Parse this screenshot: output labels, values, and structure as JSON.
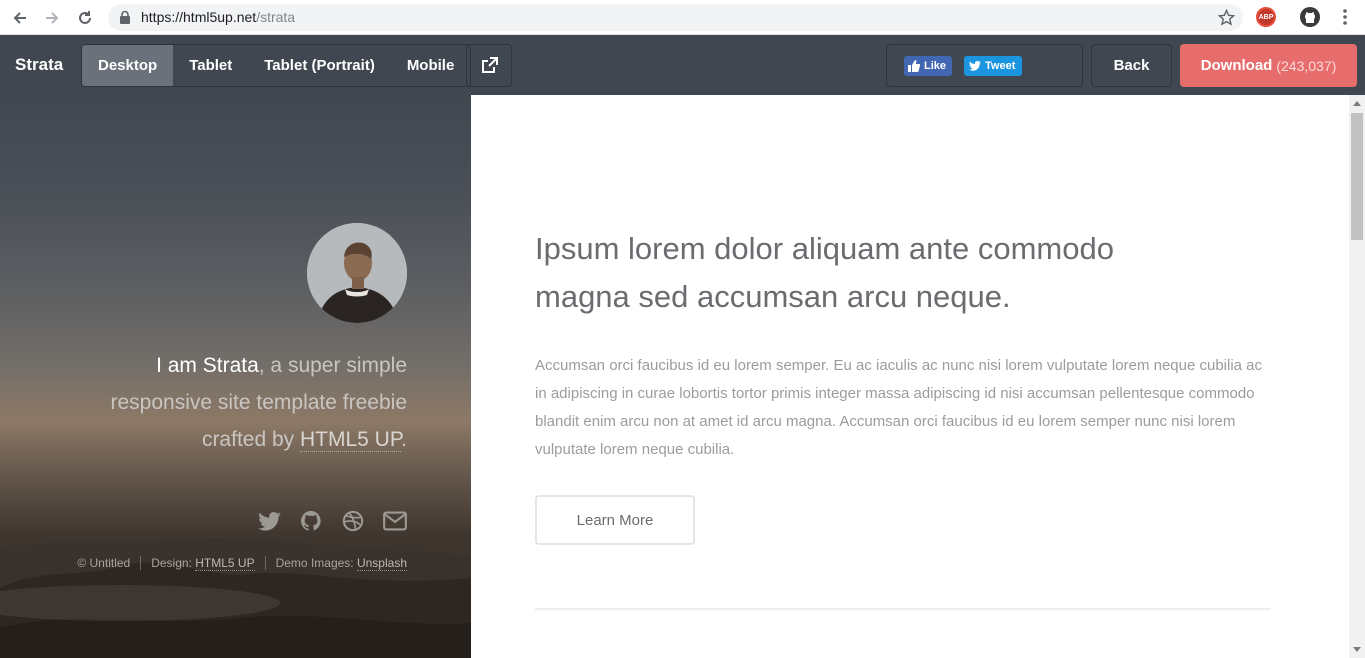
{
  "browser": {
    "url_host": "https://html5up.net",
    "url_path": "/strata",
    "extensions": [
      {
        "name": "adblock-plus-icon",
        "label": "ABP"
      },
      {
        "name": "github-extension-icon"
      }
    ]
  },
  "toolbar": {
    "brand": "Strata",
    "viewports": [
      {
        "label": "Desktop",
        "active": true
      },
      {
        "label": "Tablet",
        "active": false
      },
      {
        "label": "Tablet (Portrait)",
        "active": false
      },
      {
        "label": "Mobile",
        "active": false
      }
    ],
    "popout_icon": "external-link-icon",
    "like_label": "Like",
    "tweet_label": "Tweet",
    "back_label": "Back",
    "download_label": "Download",
    "download_count": "(243,037)",
    "colors": {
      "bar": "#414750",
      "download": "#e76d6d",
      "active_tab": "#6b717b"
    }
  },
  "sidebar": {
    "intro_strong": "I am Strata",
    "intro_text": ", a super simple responsive site template freebie crafted by ",
    "intro_link": "HTML5 UP",
    "intro_end": ".",
    "social_icons": [
      "twitter-icon",
      "github-icon",
      "dribbble-icon",
      "envelope-icon"
    ],
    "copyright": {
      "owner": "© Untitled",
      "design_label": "Design:",
      "design_link": "HTML5 UP",
      "images_label": "Demo Images:",
      "images_link": "Unsplash"
    }
  },
  "main": {
    "title": "Ipsum lorem dolor aliquam ante commodo magna sed accumsan arcu neque.",
    "body": "Accumsan orci faucibus id eu lorem semper. Eu ac iaculis ac nunc nisi lorem vulputate lorem neque cubilia ac in adipiscing in curae lobortis tortor primis integer massa adipiscing id nisi accumsan pellentesque commodo blandit enim arcu non at amet id arcu magna. Accumsan orci faucibus id eu lorem semper nunc nisi lorem vulputate lorem neque cubilia.",
    "button_label": "Learn More"
  }
}
